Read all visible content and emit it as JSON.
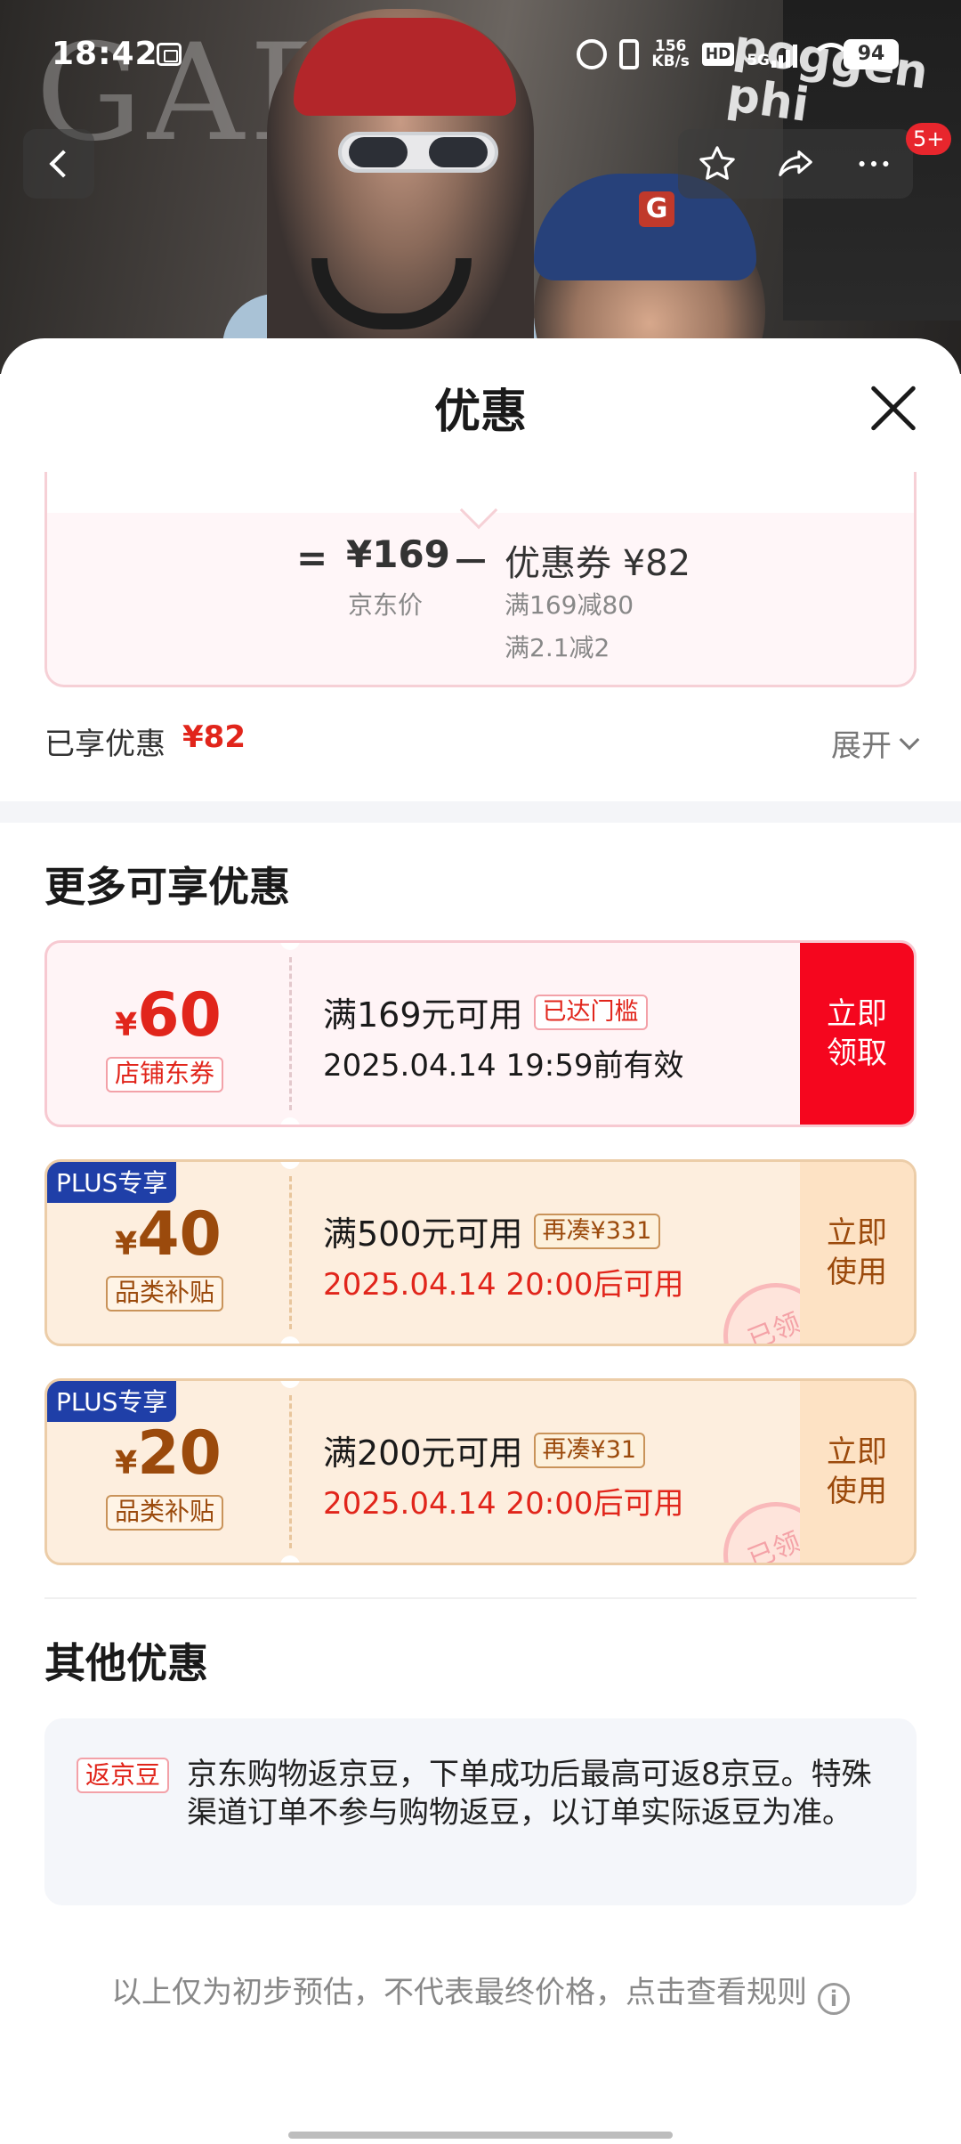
{
  "status_bar": {
    "time": "18:42",
    "net_speed_value": "156",
    "net_speed_unit": "KB/s",
    "hd_label": "HD",
    "network_label": "5G",
    "battery": "94"
  },
  "hero": {
    "brand_watermark": "GAP",
    "sign_text": "poggen\nphi"
  },
  "nav": {
    "more_badge": "5+"
  },
  "sheet": {
    "title": "优惠",
    "calc": {
      "equals": "=",
      "price": "¥169",
      "price_label": "京东价",
      "minus": "－",
      "coupon": "优惠券 ¥82",
      "rule1": "满169减80",
      "rule2": "满2.1减2"
    },
    "saved_label": "已享优惠",
    "saved_value": "¥82",
    "expand_label": "展开",
    "more_title": "更多可享优惠",
    "coupons": [
      {
        "yen": "¥",
        "amount": "60",
        "tag": "店铺东券",
        "line1": "满169元可用",
        "line1_tag": "已达门槛",
        "line2": "2025.04.14 19:59前有效",
        "action": "立即\n领取"
      },
      {
        "plus": "PLUS专享",
        "yen": "¥",
        "amount": "40",
        "tag": "品类补贴",
        "line1": "满500元可用",
        "line1_tag": "再凑¥331",
        "line2": "2025.04.14 20:00后可用",
        "action": "立即\n使用",
        "stamp": "已领"
      },
      {
        "plus": "PLUS专享",
        "yen": "¥",
        "amount": "20",
        "tag": "品类补贴",
        "line1": "满200元可用",
        "line1_tag": "再凑¥31",
        "line2": "2025.04.14 20:00后可用",
        "action": "立即\n使用",
        "stamp": "已领"
      }
    ],
    "other_title": "其他优惠",
    "other": {
      "tag": "返京豆",
      "text": "京东购物返京豆，下单成功后最高可返8京豆。特殊渠道订单不参与购物返豆，以订单实际返豆为准。"
    },
    "footer_note": "以上仅为初步预估，不代表最终价格，点击查看规则",
    "footer_icon": "i"
  }
}
